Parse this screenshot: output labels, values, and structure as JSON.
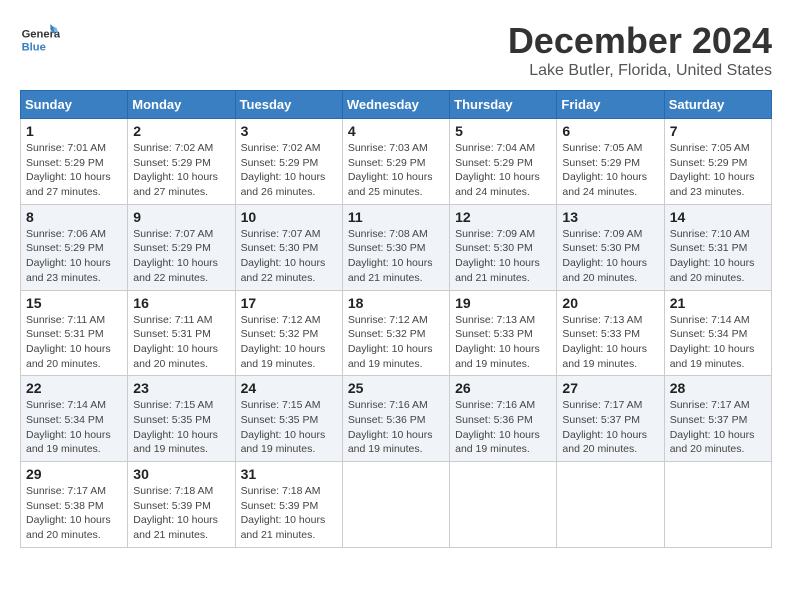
{
  "header": {
    "logo_general": "General",
    "logo_blue": "Blue",
    "title": "December 2024",
    "subtitle": "Lake Butler, Florida, United States"
  },
  "calendar": {
    "days_of_week": [
      "Sunday",
      "Monday",
      "Tuesday",
      "Wednesday",
      "Thursday",
      "Friday",
      "Saturday"
    ],
    "weeks": [
      [
        {
          "day": "1",
          "info": "Sunrise: 7:01 AM\nSunset: 5:29 PM\nDaylight: 10 hours\nand 27 minutes."
        },
        {
          "day": "2",
          "info": "Sunrise: 7:02 AM\nSunset: 5:29 PM\nDaylight: 10 hours\nand 27 minutes."
        },
        {
          "day": "3",
          "info": "Sunrise: 7:02 AM\nSunset: 5:29 PM\nDaylight: 10 hours\nand 26 minutes."
        },
        {
          "day": "4",
          "info": "Sunrise: 7:03 AM\nSunset: 5:29 PM\nDaylight: 10 hours\nand 25 minutes."
        },
        {
          "day": "5",
          "info": "Sunrise: 7:04 AM\nSunset: 5:29 PM\nDaylight: 10 hours\nand 24 minutes."
        },
        {
          "day": "6",
          "info": "Sunrise: 7:05 AM\nSunset: 5:29 PM\nDaylight: 10 hours\nand 24 minutes."
        },
        {
          "day": "7",
          "info": "Sunrise: 7:05 AM\nSunset: 5:29 PM\nDaylight: 10 hours\nand 23 minutes."
        }
      ],
      [
        {
          "day": "8",
          "info": "Sunrise: 7:06 AM\nSunset: 5:29 PM\nDaylight: 10 hours\nand 23 minutes."
        },
        {
          "day": "9",
          "info": "Sunrise: 7:07 AM\nSunset: 5:29 PM\nDaylight: 10 hours\nand 22 minutes."
        },
        {
          "day": "10",
          "info": "Sunrise: 7:07 AM\nSunset: 5:30 PM\nDaylight: 10 hours\nand 22 minutes."
        },
        {
          "day": "11",
          "info": "Sunrise: 7:08 AM\nSunset: 5:30 PM\nDaylight: 10 hours\nand 21 minutes."
        },
        {
          "day": "12",
          "info": "Sunrise: 7:09 AM\nSunset: 5:30 PM\nDaylight: 10 hours\nand 21 minutes."
        },
        {
          "day": "13",
          "info": "Sunrise: 7:09 AM\nSunset: 5:30 PM\nDaylight: 10 hours\nand 20 minutes."
        },
        {
          "day": "14",
          "info": "Sunrise: 7:10 AM\nSunset: 5:31 PM\nDaylight: 10 hours\nand 20 minutes."
        }
      ],
      [
        {
          "day": "15",
          "info": "Sunrise: 7:11 AM\nSunset: 5:31 PM\nDaylight: 10 hours\nand 20 minutes."
        },
        {
          "day": "16",
          "info": "Sunrise: 7:11 AM\nSunset: 5:31 PM\nDaylight: 10 hours\nand 20 minutes."
        },
        {
          "day": "17",
          "info": "Sunrise: 7:12 AM\nSunset: 5:32 PM\nDaylight: 10 hours\nand 19 minutes."
        },
        {
          "day": "18",
          "info": "Sunrise: 7:12 AM\nSunset: 5:32 PM\nDaylight: 10 hours\nand 19 minutes."
        },
        {
          "day": "19",
          "info": "Sunrise: 7:13 AM\nSunset: 5:33 PM\nDaylight: 10 hours\nand 19 minutes."
        },
        {
          "day": "20",
          "info": "Sunrise: 7:13 AM\nSunset: 5:33 PM\nDaylight: 10 hours\nand 19 minutes."
        },
        {
          "day": "21",
          "info": "Sunrise: 7:14 AM\nSunset: 5:34 PM\nDaylight: 10 hours\nand 19 minutes."
        }
      ],
      [
        {
          "day": "22",
          "info": "Sunrise: 7:14 AM\nSunset: 5:34 PM\nDaylight: 10 hours\nand 19 minutes."
        },
        {
          "day": "23",
          "info": "Sunrise: 7:15 AM\nSunset: 5:35 PM\nDaylight: 10 hours\nand 19 minutes."
        },
        {
          "day": "24",
          "info": "Sunrise: 7:15 AM\nSunset: 5:35 PM\nDaylight: 10 hours\nand 19 minutes."
        },
        {
          "day": "25",
          "info": "Sunrise: 7:16 AM\nSunset: 5:36 PM\nDaylight: 10 hours\nand 19 minutes."
        },
        {
          "day": "26",
          "info": "Sunrise: 7:16 AM\nSunset: 5:36 PM\nDaylight: 10 hours\nand 19 minutes."
        },
        {
          "day": "27",
          "info": "Sunrise: 7:17 AM\nSunset: 5:37 PM\nDaylight: 10 hours\nand 20 minutes."
        },
        {
          "day": "28",
          "info": "Sunrise: 7:17 AM\nSunset: 5:37 PM\nDaylight: 10 hours\nand 20 minutes."
        }
      ],
      [
        {
          "day": "29",
          "info": "Sunrise: 7:17 AM\nSunset: 5:38 PM\nDaylight: 10 hours\nand 20 minutes."
        },
        {
          "day": "30",
          "info": "Sunrise: 7:18 AM\nSunset: 5:39 PM\nDaylight: 10 hours\nand 21 minutes."
        },
        {
          "day": "31",
          "info": "Sunrise: 7:18 AM\nSunset: 5:39 PM\nDaylight: 10 hours\nand 21 minutes."
        },
        {
          "day": "",
          "info": ""
        },
        {
          "day": "",
          "info": ""
        },
        {
          "day": "",
          "info": ""
        },
        {
          "day": "",
          "info": ""
        }
      ]
    ]
  }
}
